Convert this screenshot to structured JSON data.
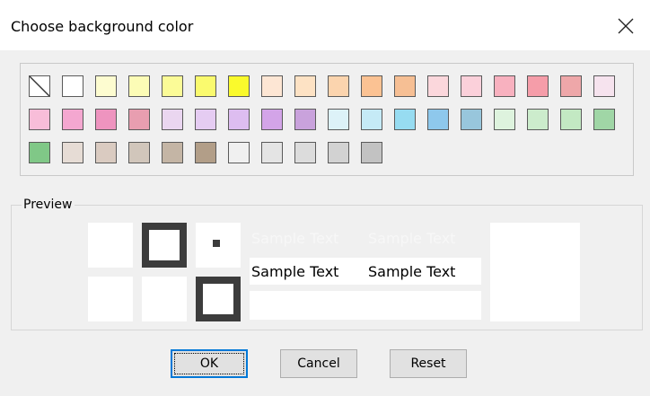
{
  "dialog": {
    "title": "Choose background color",
    "close_icon": "close-icon"
  },
  "palette": {
    "rows": [
      [
        "none",
        "#ffffff",
        "#fdfcd0",
        "#fcfcb6",
        "#fbfb97",
        "#fafa6e",
        "#fafa2c",
        "#fde6d4",
        "#fde2c4",
        "#fbd4ae",
        "#fbc293",
        "#f6bf94",
        "#fbd7dc",
        "#fbd0da",
        "#f8b1bf",
        "#f59da9",
        "#eea7a9",
        "#f6e3ee"
      ],
      [
        "#f8bdd9",
        "#f4a7d0",
        "#ee94bf",
        "#e89eb0",
        "#ead6f0",
        "#e5ccf2",
        "#ddbdf0",
        "#d3a4e8",
        "#c9a2dc",
        "#ddf2f8",
        "#c5eaf6",
        "#97dcf1",
        "#8ec8ec",
        "#98c6dc",
        "#def3de",
        "#cceccc",
        "#c3e9c3",
        "#a0d6a6"
      ],
      [
        "#80c887",
        "#e6dcd5",
        "#dacbc1",
        "#d1c6bb",
        "#c4b5a5",
        "#b29e88",
        "#f0f0f0",
        "#e4e4e4",
        "#dcdcdc",
        "#d2d2d2",
        "#c2c2c2"
      ]
    ]
  },
  "preview": {
    "label": "Preview",
    "sample_text": "Sample Text",
    "faded_color": "#f7f7f7"
  },
  "buttons": {
    "ok": "OK",
    "cancel": "Cancel",
    "reset": "Reset"
  },
  "colors": {
    "accent": "#0078d7",
    "border_dark": "#3c3c3c"
  }
}
